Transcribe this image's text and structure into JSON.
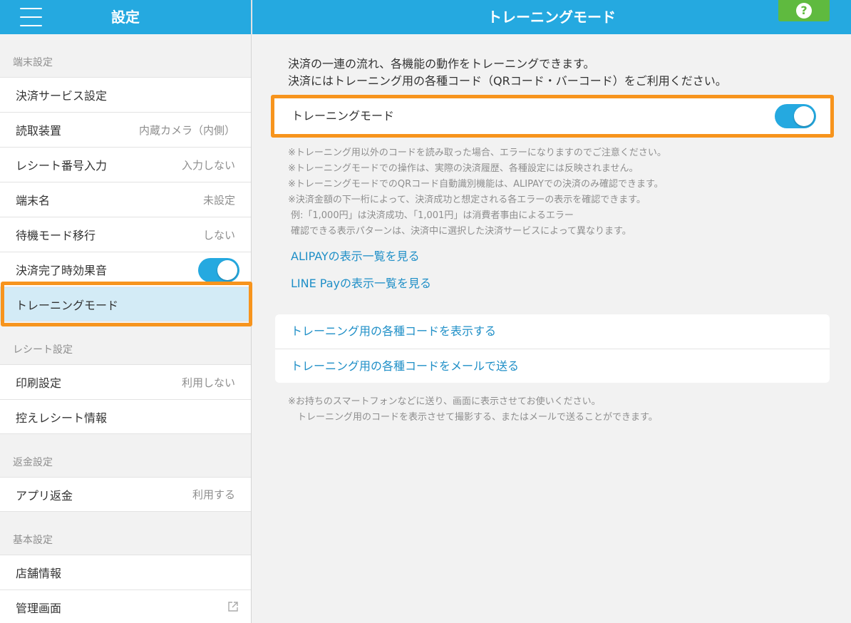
{
  "sidebar": {
    "title": "設定",
    "sections": {
      "terminal": "端末設定",
      "receipt": "レシート設定",
      "refund": "返金設定",
      "basic": "基本設定"
    },
    "items": {
      "payment_service": {
        "label": "決済サービス設定"
      },
      "reader": {
        "label": "読取装置",
        "value": "内蔵カメラ（内側）"
      },
      "receipt_number": {
        "label": "レシート番号入力",
        "value": "入力しない"
      },
      "terminal_name": {
        "label": "端末名",
        "value": "未設定"
      },
      "standby": {
        "label": "待機モード移行",
        "value": "しない"
      },
      "sound": {
        "label": "決済完了時効果音",
        "toggle": true
      },
      "training": {
        "label": "トレーニングモード"
      },
      "print": {
        "label": "印刷設定",
        "value": "利用しない"
      },
      "copy_receipt": {
        "label": "控えレシート情報"
      },
      "app_refund": {
        "label": "アプリ返金",
        "value": "利用する"
      },
      "store_info": {
        "label": "店舗情報"
      },
      "admin": {
        "label": "管理画面"
      }
    }
  },
  "main": {
    "title": "トレーニングモード",
    "help_icon": "question-mark-icon",
    "intro": [
      "決済の一連の流れ、各機能の動作をトレーニングできます。",
      "決済にはトレーニング用の各種コード（QRコード・バーコード）をご利用ください。"
    ],
    "toggle_label": "トレーニングモード",
    "toggle_on": true,
    "notes": [
      "※トレーニング用以外のコードを読み取った場合、エラーになりますのでご注意ください。",
      "※トレーニングモードでの操作は、実際の決済履歴、各種設定には反映されません。",
      "※トレーニングモードでのQRコード自動識別機能は、ALIPAYでの決済のみ確認できます。",
      "※決済金額の下一桁によって、決済成功と想定される各エラーの表示を確認できます。",
      " 例:「1,000円」は決済成功、「1,001円」は消費者事由によるエラー",
      " 確認できる表示パターンは、決済中に選択した決済サービスによって異なります。"
    ],
    "link_alipay": "ALIPAYの表示一覧を見る",
    "link_linepay": "LINE Payの表示一覧を見る",
    "show_codes": "トレーニング用の各種コードを表示する",
    "mail_codes": "トレーニング用の各種コードをメールで送る",
    "notes2": [
      "※お持ちのスマートフォンなどに送り、画面に表示させてお使いください。",
      "　トレーニング用のコードを表示させて撮影する、またはメールで送ることができます。"
    ]
  },
  "colors": {
    "accent": "#25a9e0",
    "highlight": "#f7941d",
    "help": "#5fba3f",
    "link": "#1f8fc7"
  }
}
